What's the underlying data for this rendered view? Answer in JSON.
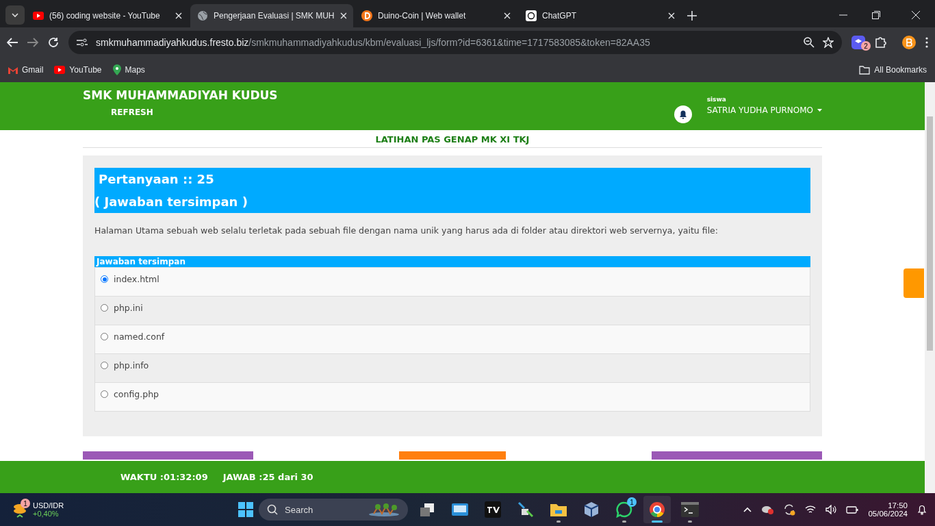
{
  "browser": {
    "tabs": [
      {
        "title": "(56) coding website - YouTube",
        "kind": "youtube",
        "selected": false
      },
      {
        "title": "Pengerjaan Evaluasi | SMK MUH",
        "kind": "globe",
        "selected": true
      },
      {
        "title": "Duino-Coin | Web wallet",
        "kind": "coin",
        "selected": false
      },
      {
        "title": "ChatGPT",
        "kind": "chat",
        "selected": false
      }
    ],
    "url_host": "smkmuhammadiyahkudus.fresto.biz",
    "url_path": "/smkmuhammadiyahkudus/kbm/evaluasi_ljs/form?id=6361&time=1717583085&token=82AA35",
    "extension_badge": "2",
    "bookmarks": [
      {
        "label": "Gmail",
        "kind": "mail"
      },
      {
        "label": "YouTube",
        "kind": "youtube"
      },
      {
        "label": "Maps",
        "kind": "pin"
      }
    ],
    "all_bookmarks": "All Bookmarks"
  },
  "header": {
    "school": "SMK MUHAMMADIYAH KUDUS",
    "refresh": "REFRESH",
    "role": "siswa",
    "user": "SATRIA YUDHA PURNOMO"
  },
  "exam_title": "LATIHAN PAS GENAP MK XI TKJ",
  "question": {
    "number": "Pertanyaan :: 25",
    "status": "( Jawaban tersimpan )",
    "text": "Halaman Utama sebuah web selalu terletak pada sebuah file dengan nama unik yang harus ada di folder atau direktori web servernya, yaitu file:",
    "answer_header": "Jawaban tersimpan",
    "options": [
      {
        "label": "index.html",
        "selected": true
      },
      {
        "label": "php.ini",
        "selected": false
      },
      {
        "label": "named.conf",
        "selected": false
      },
      {
        "label": "php.info",
        "selected": false
      },
      {
        "label": "config.php",
        "selected": false
      }
    ]
  },
  "nav_buttons": [
    {
      "color": "#9b59b6"
    },
    {
      "color": "#ff7f0e"
    },
    {
      "color": "#9b59b6"
    }
  ],
  "footer": {
    "time": "WAKTU :01:32:09",
    "answered": "JAWAB :25 dari 30"
  },
  "taskbar": {
    "widget": {
      "badge": "1",
      "pair": "USD/IDR",
      "change": "+0,40%"
    },
    "search": "Search",
    "apps": [
      {
        "kind": "taskview",
        "running": false,
        "active": false
      },
      {
        "kind": "monitor",
        "running": false,
        "active": false
      },
      {
        "kind": "chart",
        "running": false,
        "active": false
      },
      {
        "kind": "lock",
        "running": false,
        "active": false
      },
      {
        "kind": "folder",
        "running": true,
        "active": false
      },
      {
        "kind": "cube",
        "running": false,
        "active": false
      },
      {
        "kind": "whatsapp",
        "badge": "1",
        "running": true,
        "active": false
      },
      {
        "kind": "chrome",
        "running": true,
        "active": true
      },
      {
        "kind": "terminal",
        "running": true,
        "active": false
      }
    ],
    "time": "17:50",
    "date": "05/06/2024"
  }
}
